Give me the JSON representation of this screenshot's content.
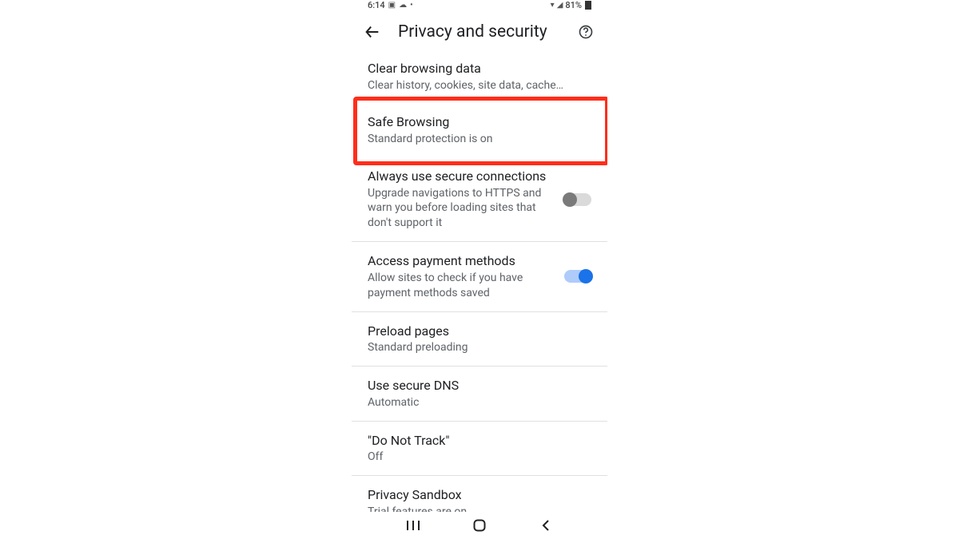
{
  "statusbar": {
    "time": "6:14",
    "battery_pct": "81%"
  },
  "header": {
    "title": "Privacy and security"
  },
  "items": [
    {
      "label": "Clear browsing data",
      "sub": "Clear history, cookies, site data, cache…"
    },
    {
      "label": "Safe Browsing",
      "sub": "Standard protection is on",
      "highlighted": true
    },
    {
      "label": "Always use secure connections",
      "sub": "Upgrade navigations to HTTPS and warn you before loading sites that don't support it",
      "toggle": "off"
    },
    {
      "label": "Access payment methods",
      "sub": "Allow sites to check if you have payment methods saved",
      "toggle": "on"
    },
    {
      "label": "Preload pages",
      "sub": "Standard preloading"
    },
    {
      "label": "Use secure DNS",
      "sub": "Automatic"
    },
    {
      "label": "\"Do Not Track\"",
      "sub": "Off"
    },
    {
      "label": "Privacy Sandbox",
      "sub": "Trial features are on"
    }
  ],
  "colors": {
    "highlight_border": "#ff2d1a",
    "toggle_on_track": "#aecbfa",
    "toggle_on_thumb": "#1a73e8"
  }
}
